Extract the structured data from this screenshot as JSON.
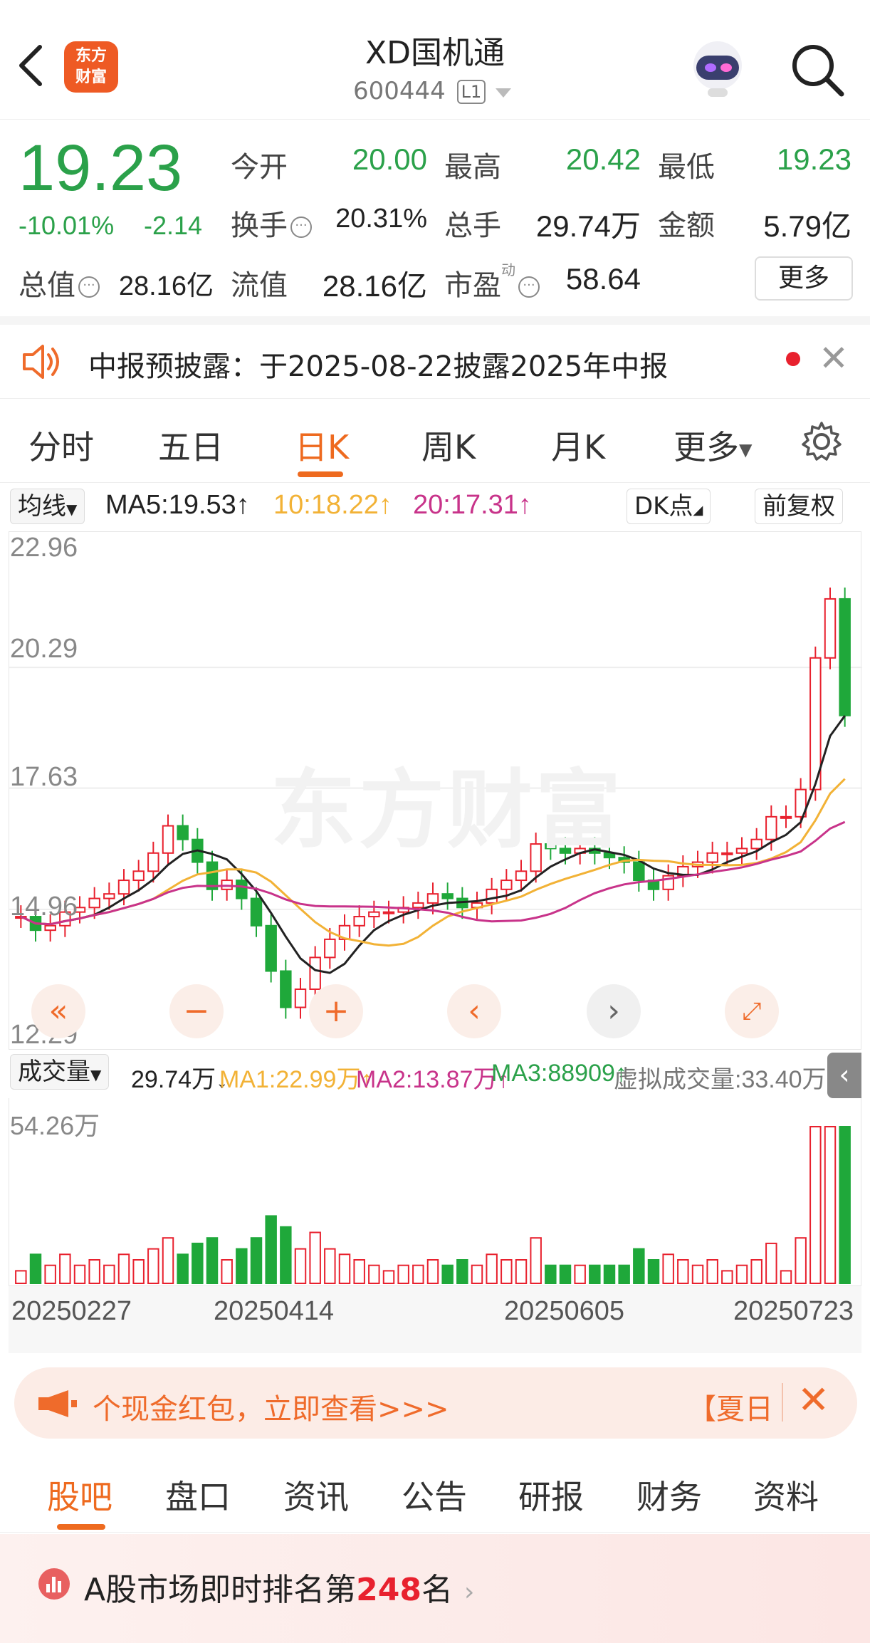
{
  "header": {
    "logo_text": "东方财富",
    "stock_name": "XD国机通",
    "stock_code": "600444",
    "level_badge": "L1"
  },
  "quote": {
    "price": "19.23",
    "change_pct": "-10.01%",
    "change_abs": "-2.14",
    "rows": [
      [
        {
          "label": "今开",
          "value": "20.00",
          "color": "green"
        },
        {
          "label": "最高",
          "value": "20.42",
          "color": "green"
        },
        {
          "label": "最低",
          "value": "19.23",
          "color": "green"
        }
      ],
      [
        {
          "label": "换手",
          "value": "20.31%"
        },
        {
          "label": "总手",
          "value": "29.74万"
        },
        {
          "label": "金额",
          "value": "5.79亿"
        }
      ],
      [
        {
          "label": "总值",
          "value": "28.16亿"
        },
        {
          "label": "流值",
          "value": "28.16亿"
        },
        {
          "label": "市盈",
          "sup": "动",
          "value": "58.64"
        }
      ]
    ],
    "more_button": "更多",
    "colors": {
      "down": "#2ba14a",
      "up": "#e8212e",
      "accent": "#ee6a1f"
    }
  },
  "notice": {
    "text": "中报预披露：于2025-08-22披露2025年中报"
  },
  "chart_tabs": [
    "分时",
    "五日",
    "日K",
    "周K",
    "月K",
    "更多"
  ],
  "active_chart_tab": "日K",
  "ma_bar": {
    "selector": "均线",
    "ma5": "MA5:19.53↑",
    "ma10": "10:18.22↑",
    "ma20": "20:17.31↑",
    "dk_button": "DK点",
    "adjust_button": "前复权"
  },
  "kline": {
    "watermark": "东方财富",
    "y_labels": [
      "22.96",
      "20.29",
      "17.63",
      "14.96",
      "12.29"
    ]
  },
  "volume_bar": {
    "selector": "成交量",
    "vol": "29.74万↓",
    "ma1": "MA1:22.99万↑",
    "ma2": "MA2:13.87万↑",
    "ma3": "MA3:88909↑",
    "virtual": "虚拟成交量:33.40万",
    "max_label": "54.26万"
  },
  "dates": [
    "20250227",
    "20250414",
    "20250605",
    "20250723"
  ],
  "chart_data": {
    "type": "candlestick",
    "ylim": [
      12.29,
      22.96
    ],
    "y_ticks": [
      22.96,
      20.29,
      17.63,
      14.96,
      12.29
    ],
    "x_ticks": [
      "20250227",
      "20250414",
      "20250605",
      "20250723"
    ],
    "series": [
      {
        "name": "MA5",
        "last": 19.53
      },
      {
        "name": "MA10",
        "last": 18.22
      },
      {
        "name": "MA20",
        "last": 17.31
      }
    ],
    "close": [
      14.8,
      14.5,
      14.6,
      14.9,
      15.0,
      15.2,
      15.3,
      15.6,
      15.8,
      16.2,
      16.8,
      16.5,
      16.0,
      15.4,
      15.6,
      15.2,
      14.6,
      13.6,
      12.8,
      13.2,
      13.9,
      14.3,
      14.6,
      14.8,
      14.9,
      14.9,
      15.0,
      15.1,
      15.3,
      15.2,
      15.0,
      15.1,
      15.4,
      15.6,
      15.8,
      16.4,
      16.3,
      16.2,
      16.3,
      16.2,
      16.1,
      16.0,
      15.6,
      15.4,
      15.7,
      15.9,
      16.0,
      16.2,
      16.2,
      16.3,
      16.5,
      17.0,
      17.0,
      17.6,
      20.5,
      21.8,
      19.23
    ],
    "volume": {
      "max_label": "54.26万",
      "last": "29.74万"
    }
  },
  "promo": {
    "text": "个现金红包，立即查看>>>",
    "right": "【夏日"
  },
  "bottom_tabs": [
    "股吧",
    "盘口",
    "资讯",
    "公告",
    "研报",
    "财务",
    "资料"
  ],
  "active_bottom_tab": "股吧",
  "rank": {
    "prefix": "A股市场即时排名第",
    "number": "248",
    "suffix": "名"
  }
}
